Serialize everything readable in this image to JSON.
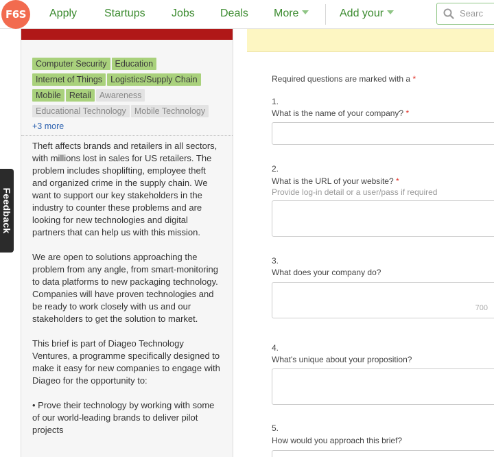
{
  "nav": {
    "logo": "F6S",
    "apply": "Apply",
    "startups": "Startups",
    "jobs": "Jobs",
    "deals": "Deals",
    "more": "More",
    "add_your": "Add your",
    "search_placeholder": "Searc"
  },
  "feedback": "Feedback",
  "tags": {
    "active": [
      "Computer Security",
      "Education",
      "Internet of Things",
      "Logistics/Supply Chain",
      "Mobile",
      "Retail"
    ],
    "inactive": [
      "Awareness",
      "Educational Technology",
      "Mobile Technology"
    ],
    "more": "+3 more"
  },
  "brief": {
    "p1": "Theft affects brands and retailers in all sectors, with millions lost in sales for US retailers. The problem includes shoplifting, employee theft and organized crime in the supply chain. We want to support our key stakeholders in the industry to counter these problems and are looking for new technologies and digital partners that can help us with this mission.",
    "p2": "We are open to solutions approaching the problem from any angle, from smart-monitoring to data platforms to new packaging technology. Companies will have proven technologies and be ready to work closely with us and our stakeholders to get the solution to market.",
    "p3": "This brief is part of Diageo Technology Ventures, a programme specifically designed to make it easy for new companies to engage with Diageo for the opportunity to:",
    "p4": "• Prove their technology by working with some of our world-leading brands to deliver pilot projects"
  },
  "form": {
    "required_note": "Required questions are marked with a",
    "required_mark": "*",
    "questions": [
      {
        "num": "1.",
        "label": "What is the name of your company?",
        "required": true,
        "hint": ""
      },
      {
        "num": "2.",
        "label": "What is the URL of your website?",
        "required": true,
        "hint": "Provide log-in detail or a user/pass if required"
      },
      {
        "num": "3.",
        "label": "What does your company do?",
        "required": false,
        "hint": "",
        "counter": "700"
      },
      {
        "num": "4.",
        "label": "What's unique about your proposition?",
        "required": false,
        "hint": ""
      },
      {
        "num": "5.",
        "label": "How would you approach this brief?",
        "required": false,
        "hint": ""
      }
    ]
  },
  "colors": {
    "nav_green": "#3a8a2e",
    "logo": "#f26b4f",
    "tag_active": "#a9d17c",
    "tag_inactive": "#e3e3e3",
    "red_bar": "#b01818",
    "notice": "#fdf6c2",
    "required_star": "#e0332a",
    "link": "#2f63b0"
  }
}
